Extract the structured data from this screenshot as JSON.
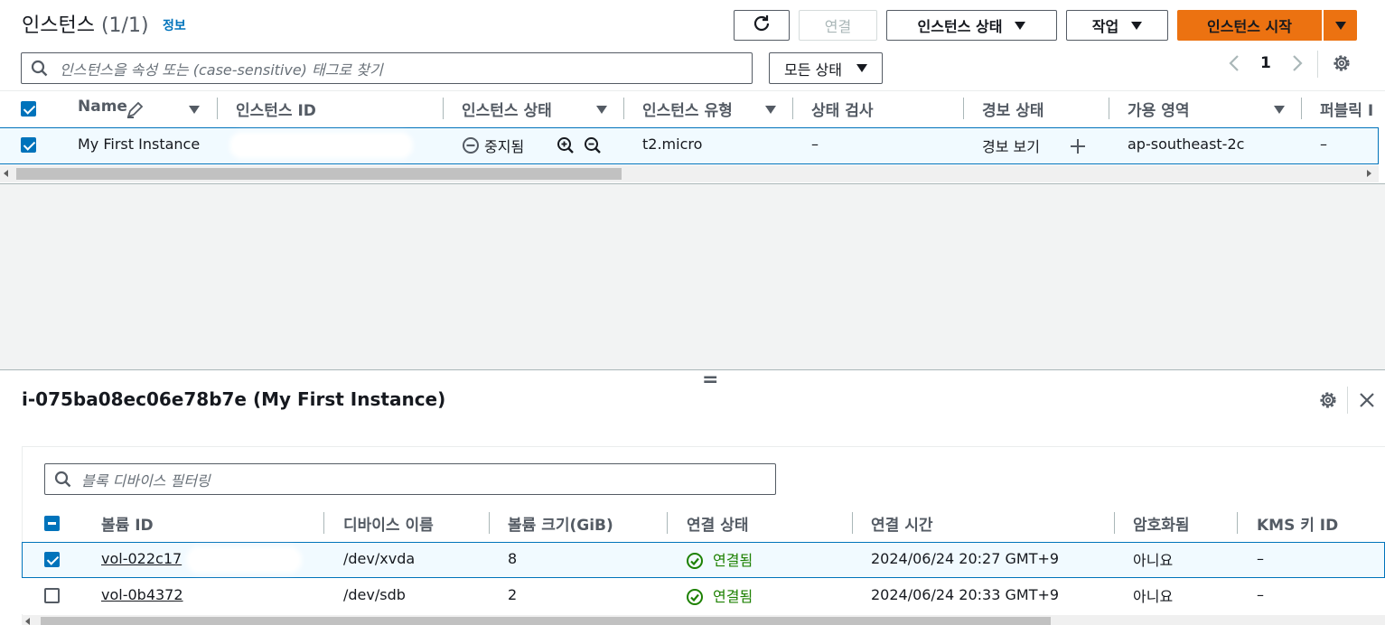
{
  "header": {
    "title": "인스턴스",
    "count": "(1/1)",
    "info_link": "정보"
  },
  "toolbar": {
    "connect_label": "연결",
    "instance_state_label": "인스턴스 상태",
    "actions_label": "작업",
    "launch_label": "인스턴스 시작"
  },
  "search": {
    "placeholder": "인스턴스을 속성 또는 (case-sensitive) 태그로 찾기",
    "state_filter": "모든 상태"
  },
  "pagination": {
    "page": "1"
  },
  "instances_table": {
    "columns": [
      "Name",
      "인스턴스 ID",
      "인스턴스 상태",
      "인스턴스 유형",
      "상태 검사",
      "경보 상태",
      "가용 영역",
      "퍼블릭 I"
    ],
    "rows": [
      {
        "name": "My First Instance",
        "instance_id": "",
        "state": "중지됨",
        "type": "t2.micro",
        "status_check": "–",
        "alarm": "경보 보기",
        "az": "ap-southeast-2c",
        "public": "–"
      }
    ]
  },
  "details": {
    "handle": "=",
    "title": "i-075ba08ec06e78b7e (My First Instance)",
    "filter_placeholder": "블록 디바이스 필터링",
    "columns": [
      "볼륨 ID",
      "디바이스 이름",
      "볼륨 크기(GiB)",
      "연결 상태",
      "연결 시간",
      "암호화됨",
      "KMS 키 ID"
    ],
    "rows": [
      {
        "volume_id": "vol-022c17",
        "device": "/dev/xvda",
        "size": "8",
        "status": "연결됨",
        "time": "2024/06/24 20:27 GMT+9",
        "encrypted": "아니요",
        "kms": "–",
        "checked": true
      },
      {
        "volume_id": "vol-0b4372",
        "device": "/dev/sdb",
        "size": "2",
        "status": "연결됨",
        "time": "2024/06/24 20:33 GMT+9",
        "encrypted": "아니요",
        "kms": "–",
        "checked": false
      }
    ]
  },
  "colors": {
    "primary": "#ec7211",
    "link": "#0073bb",
    "success": "#1d8102",
    "selected_row": "#f1faff"
  }
}
